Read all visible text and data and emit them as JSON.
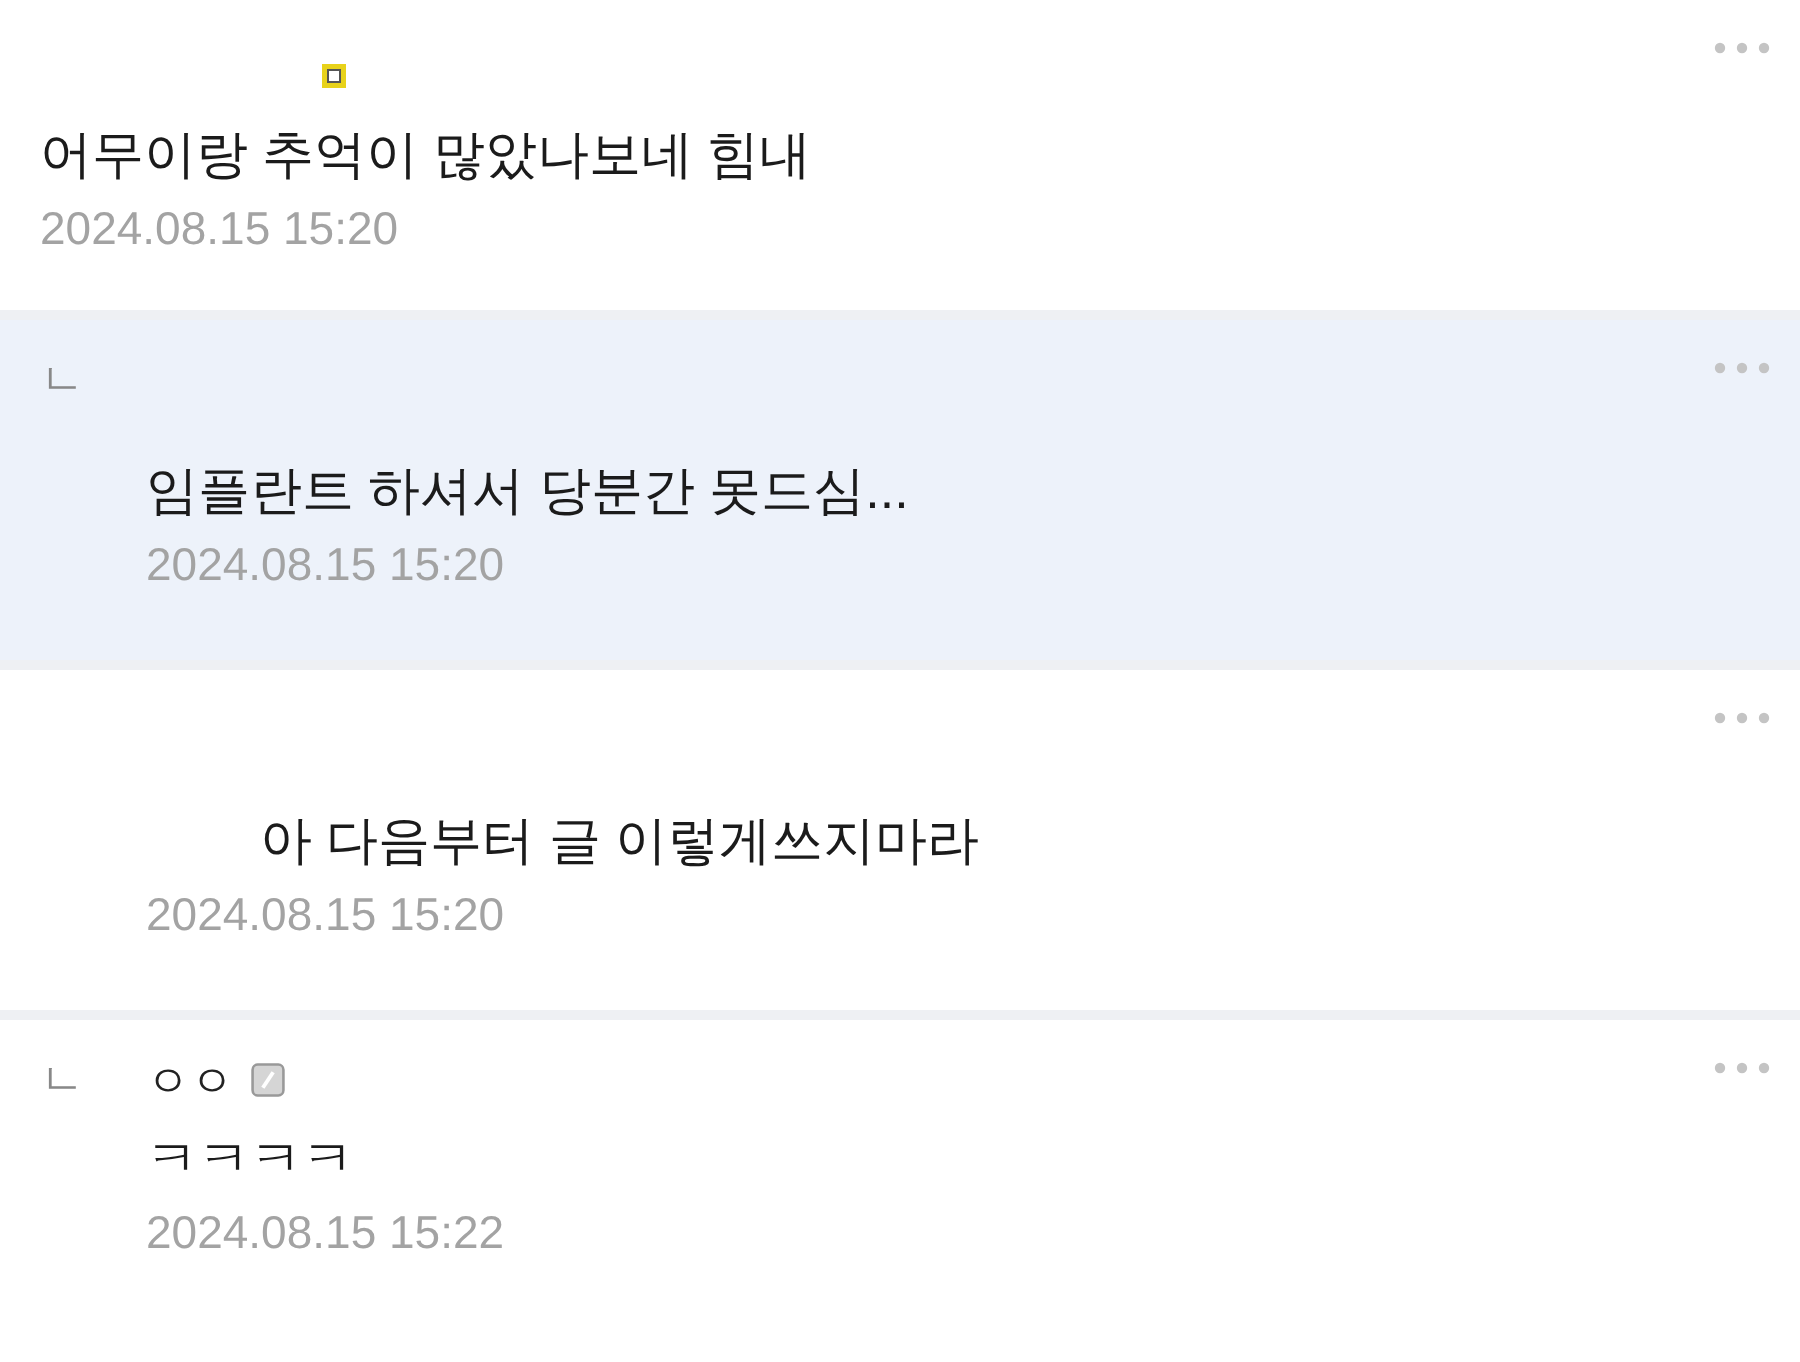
{
  "comments": [
    {
      "kind": "comment",
      "highlighted": false,
      "badge": {
        "kind": "level"
      },
      "text": "어무이랑 추억이 많았나보네 힘내",
      "date": "2024.08.15 15:20"
    },
    {
      "kind": "reply",
      "highlighted": true,
      "reply_mark": "ㄴ",
      "text": "임플란트 하셔서 당분간 못드심...",
      "date": "2024.08.15 15:20"
    },
    {
      "kind": "reply",
      "highlighted": false,
      "text": "아 다음부터 글 이렇게쓰지마라",
      "date": "2024.08.15 15:20"
    },
    {
      "kind": "reply",
      "highlighted": false,
      "reply_mark": "ㄴ",
      "nickname": "ㅇㅇ",
      "badge": {
        "kind": "guest"
      },
      "text": "ㅋㅋㅋㅋ",
      "date": "2024.08.15 15:22"
    }
  ]
}
